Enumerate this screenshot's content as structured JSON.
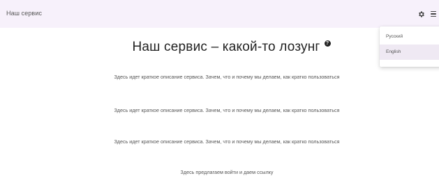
{
  "header": {
    "brand": "Наш сервис",
    "settings_icon": "gear-icon",
    "menu_icon": "hamburger-icon"
  },
  "language_menu": {
    "items": [
      "Русский",
      "English"
    ],
    "highlighted": "English"
  },
  "main": {
    "title": "Наш сервис – какой-то лозунг",
    "help_icon": "help-icon",
    "paragraphs": [
      "Здесь идет краткое описание сервиса. Зачем, что и почему мы делаем, как кратко пользоваться",
      "Здесь идет краткое описание сервиса. Зачем, что и почему мы делаем, как кратко пользоваться",
      "Здесь идет краткое описание сервиса. Зачем, что и почему мы делаем, как кратко пользоваться"
    ],
    "login_prompt": "Здесь предлагаем войти и даем ссылку"
  },
  "colors": {
    "appbar_bg": "#f7f1fb",
    "menu_highlight": "#efe9f3"
  }
}
